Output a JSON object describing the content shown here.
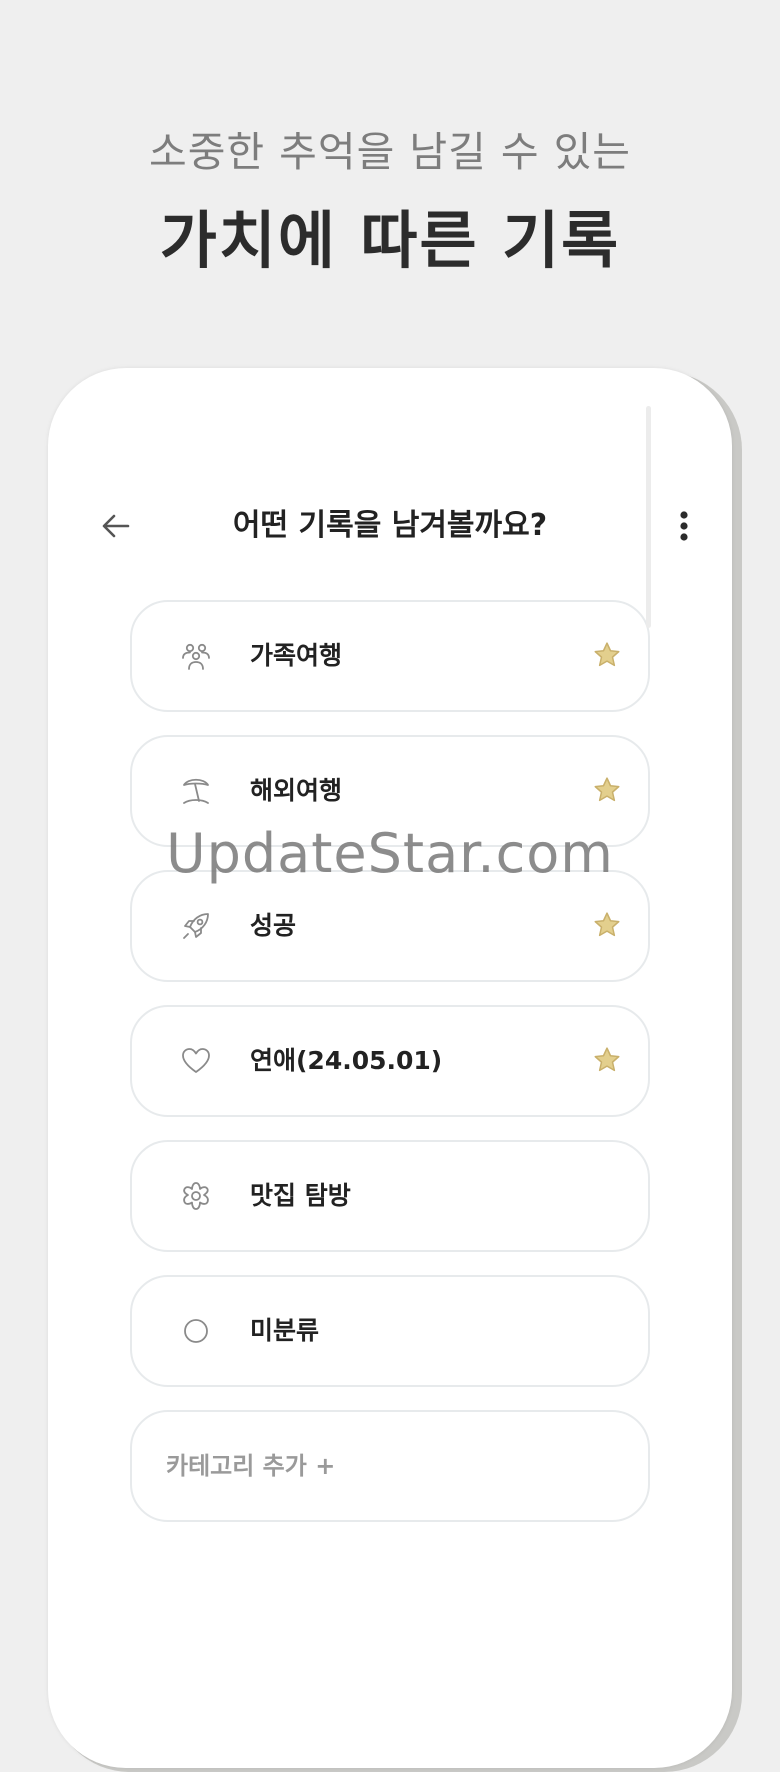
{
  "hero": {
    "subtitle": "소중한 추억을 남길 수 있는",
    "title": "가치에 따른 기록"
  },
  "header": {
    "title": "어떤 기록을 남겨볼까요?",
    "back_icon": "arrow-left-icon",
    "more_icon": "more-vertical-icon"
  },
  "categories": [
    {
      "label": "가족여행",
      "icon": "people-icon",
      "starred": true
    },
    {
      "label": "해외여행",
      "icon": "palm-tree-icon",
      "starred": true
    },
    {
      "label": "성공",
      "icon": "rocket-icon",
      "starred": true
    },
    {
      "label": "연애(24.05.01)",
      "icon": "heart-icon",
      "starred": true
    },
    {
      "label": "맛집 탐방",
      "icon": "flower-icon",
      "starred": false
    },
    {
      "label": "미분류",
      "icon": "circle-icon",
      "starred": false
    }
  ],
  "add_category": {
    "label": "카테고리 추가 +"
  },
  "colors": {
    "star": "#e3cf8d",
    "star_stroke": "#c9b06b",
    "icon_gray": "#8a8a8a",
    "border": "#e7eaec"
  },
  "watermark": "UpdateStar.com"
}
